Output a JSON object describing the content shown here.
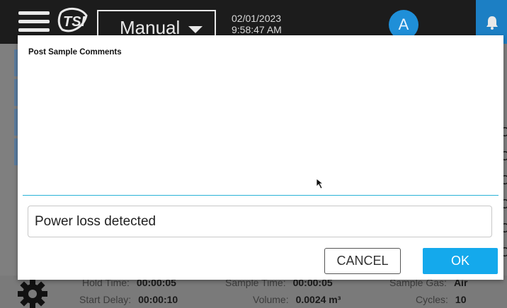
{
  "topbar": {
    "mode_label": "Manual",
    "date": "02/01/2023",
    "time": "9:58:47 AM",
    "avatar_letter": "A",
    "logo_text": "TSI"
  },
  "modal": {
    "title": "Post Sample Comments",
    "comment_value": "Power loss detected",
    "cancel_label": "CANCEL",
    "ok_label": "OK"
  },
  "background": {
    "right_letters": [
      "C",
      "C",
      "C",
      "C",
      "C",
      "C"
    ],
    "stats": {
      "hold_time_label": "Hold Time:",
      "hold_time_value": "00:00:05",
      "sample_time_label": "Sample Time:",
      "sample_time_value": "00:00:05",
      "sample_gas_label": "Sample Gas:",
      "sample_gas_value": "Air",
      "start_delay_label": "Start Delay:",
      "start_delay_value": "00:00:10",
      "volume_label": "Volume:",
      "volume_value": "0.0024 m³",
      "cycles_label": "Cycles:",
      "cycles_value": "10"
    }
  },
  "colors": {
    "accent": "#14a9ec",
    "divider": "#2ab3d6",
    "avatar": "#1f8fd8",
    "topbar": "#1c1c1c"
  },
  "icons": [
    "menu-icon",
    "tsi-logo",
    "caret-down-icon",
    "bell-icon",
    "gear-icon",
    "mouse-cursor-icon"
  ]
}
